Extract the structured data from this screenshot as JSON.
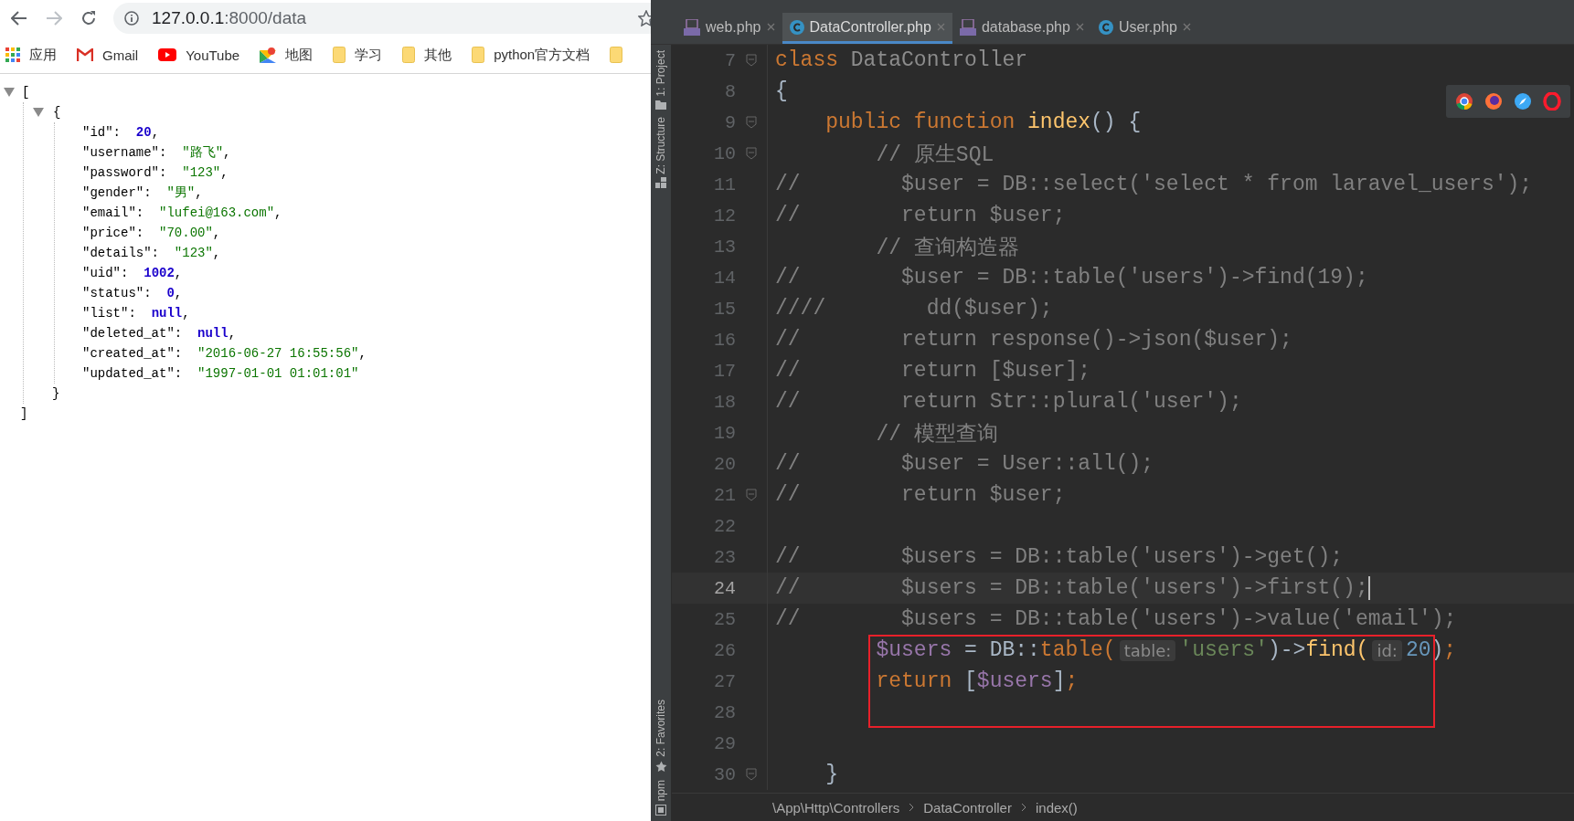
{
  "browser": {
    "address": {
      "host": "127.0.0.1",
      "path": ":8000/data"
    },
    "bookmarks": [
      {
        "kind": "apps",
        "label": "应用"
      },
      {
        "kind": "gmail",
        "label": "Gmail"
      },
      {
        "kind": "youtube",
        "label": "YouTube"
      },
      {
        "kind": "maps",
        "label": "地图"
      },
      {
        "kind": "folder",
        "label": "学习"
      },
      {
        "kind": "folder",
        "label": "其他"
      },
      {
        "kind": "folder",
        "label": "python官方文档"
      },
      {
        "kind": "folder"
      }
    ],
    "json_view": {
      "open": "[",
      "expanded": true,
      "close": "]",
      "object": {
        "open": "{",
        "expanded": true,
        "close": "}",
        "entries": [
          {
            "key": "\"id\":",
            "value": "20",
            "kind": "number",
            "suffix": ","
          },
          {
            "key": "\"username\":",
            "value": "\"路飞\"",
            "kind": "string",
            "suffix": ","
          },
          {
            "key": "\"password\":",
            "value": "\"123\"",
            "kind": "string",
            "suffix": ","
          },
          {
            "key": "\"gender\":",
            "value": "\"男\"",
            "kind": "string",
            "suffix": ","
          },
          {
            "key": "\"email\":",
            "value": "\"lufei@163.com\"",
            "kind": "string",
            "suffix": ","
          },
          {
            "key": "\"price\":",
            "value": "\"70.00\"",
            "kind": "string",
            "suffix": ","
          },
          {
            "key": "\"details\":",
            "value": "\"123\"",
            "kind": "string",
            "suffix": ","
          },
          {
            "key": "\"uid\":",
            "value": "1002",
            "kind": "number",
            "suffix": ","
          },
          {
            "key": "\"status\":",
            "value": "0",
            "kind": "number",
            "suffix": ","
          },
          {
            "key": "\"list\":",
            "value": "null",
            "kind": "null",
            "suffix": ","
          },
          {
            "key": "\"deleted_at\":",
            "value": "null",
            "kind": "null",
            "suffix": ","
          },
          {
            "key": "\"created_at\":",
            "value": "\"2016-06-27 16:55:56\"",
            "kind": "string",
            "suffix": ","
          },
          {
            "key": "\"updated_at\":",
            "value": "\"1997-01-01 01:01:01\"",
            "kind": "string"
          }
        ]
      }
    }
  },
  "ide": {
    "tabs": [
      {
        "label": "web.php",
        "kind": "php",
        "selected": false
      },
      {
        "label": "DataController.php",
        "kind": "class",
        "selected": true
      },
      {
        "label": "database.php",
        "kind": "php",
        "selected": false
      },
      {
        "label": "User.php",
        "kind": "class",
        "selected": false
      }
    ],
    "tool_windows": {
      "top": [
        {
          "label": "1: Project",
          "kind": "folder"
        },
        {
          "label": "Z: Structure",
          "kind": "structure"
        }
      ],
      "bottom": [
        {
          "label": "2: Favorites",
          "kind": "star"
        },
        {
          "label": "npm",
          "kind": "npm"
        }
      ]
    },
    "lines": [
      {
        "number": "7",
        "fold": true,
        "tokens": [
          {
            "kind": "keyword",
            "text": "class"
          },
          {
            "kind": "dim",
            "text": " DataController"
          }
        ]
      },
      {
        "number": "8",
        "tokens": [
          {
            "kind": "plain",
            "text": "{"
          }
        ]
      },
      {
        "number": "9",
        "fold": true,
        "tokens": [
          {
            "kind": "keyword",
            "text": "    public function "
          },
          {
            "kind": "function",
            "text": "index"
          },
          {
            "kind": "plain",
            "text": "() {"
          }
        ]
      },
      {
        "number": "10",
        "fold": true,
        "tokens": [
          {
            "kind": "comment",
            "text": "        // 原生SQL"
          }
        ]
      },
      {
        "number": "11",
        "tokens": [
          {
            "kind": "comment",
            "text": "//        $user = DB::select('select * from laravel_users');"
          }
        ]
      },
      {
        "number": "12",
        "tokens": [
          {
            "kind": "comment",
            "text": "//        return $user;"
          }
        ]
      },
      {
        "number": "13",
        "tokens": [
          {
            "kind": "comment",
            "text": "        // 查询构造器"
          }
        ]
      },
      {
        "number": "14",
        "tokens": [
          {
            "kind": "comment",
            "text": "//        $user = DB::table('users')->find(19);"
          }
        ]
      },
      {
        "number": "15",
        "tokens": [
          {
            "kind": "comment",
            "text": "////        dd($user);"
          }
        ]
      },
      {
        "number": "16",
        "tokens": [
          {
            "kind": "comment",
            "text": "//        return response()->json($user);"
          }
        ]
      },
      {
        "number": "17",
        "tokens": [
          {
            "kind": "comment",
            "text": "//        return [$user];"
          }
        ]
      },
      {
        "number": "18",
        "tokens": [
          {
            "kind": "comment",
            "text": "//        return Str::plural('user');"
          }
        ]
      },
      {
        "number": "19",
        "tokens": [
          {
            "kind": "comment",
            "text": "        // 模型查询"
          }
        ]
      },
      {
        "number": "20",
        "tokens": [
          {
            "kind": "comment",
            "text": "//        $user = User::all();"
          }
        ]
      },
      {
        "number": "21",
        "fold": true,
        "tokens": [
          {
            "kind": "comment",
            "text": "//        return $user;"
          }
        ]
      },
      {
        "number": "22"
      },
      {
        "number": "23",
        "tokens": [
          {
            "kind": "comment",
            "text": "//        $users = DB::table('users')->get();"
          }
        ]
      },
      {
        "number": "24",
        "current": true,
        "tokens": [
          {
            "kind": "comment",
            "text": "//        $users = DB::table('users')->first();"
          }
        ]
      },
      {
        "number": "25",
        "tokens": [
          {
            "kind": "comment",
            "text": "//        $users = DB::table('users')->value('email');"
          }
        ]
      },
      {
        "number": "26",
        "boxed": true,
        "tokens": [
          {
            "kind": "variable",
            "text": "        $users"
          },
          {
            "kind": "plain",
            "text": " = DB::"
          },
          {
            "kind": "keyword",
            "text": "table("
          },
          {
            "kind": "hint",
            "text": "table:"
          },
          {
            "kind": "string",
            "text": "'users'"
          },
          {
            "kind": "plain",
            "text": ")->"
          },
          {
            "kind": "function",
            "text": "find("
          },
          {
            "kind": "hint",
            "text": "id:"
          },
          {
            "kind": "number",
            "text": "20"
          },
          {
            "kind": "plain",
            "text": ")"
          },
          {
            "kind": "keyword",
            "text": ";"
          }
        ]
      },
      {
        "number": "27",
        "boxed": true,
        "tokens": [
          {
            "kind": "keyword",
            "text": "        return "
          },
          {
            "kind": "plain",
            "text": "["
          },
          {
            "kind": "variable",
            "text": "$users"
          },
          {
            "kind": "plain",
            "text": "]"
          },
          {
            "kind": "keyword",
            "text": ";"
          }
        ]
      },
      {
        "number": "28",
        "boxed": true
      },
      {
        "number": "29"
      },
      {
        "number": "30",
        "fold": true,
        "tokens": [
          {
            "kind": "plain",
            "text": "    }"
          }
        ]
      }
    ],
    "breadcrumbs": [
      "\\App\\Http\\Controllers",
      "DataController",
      "index()"
    ]
  }
}
